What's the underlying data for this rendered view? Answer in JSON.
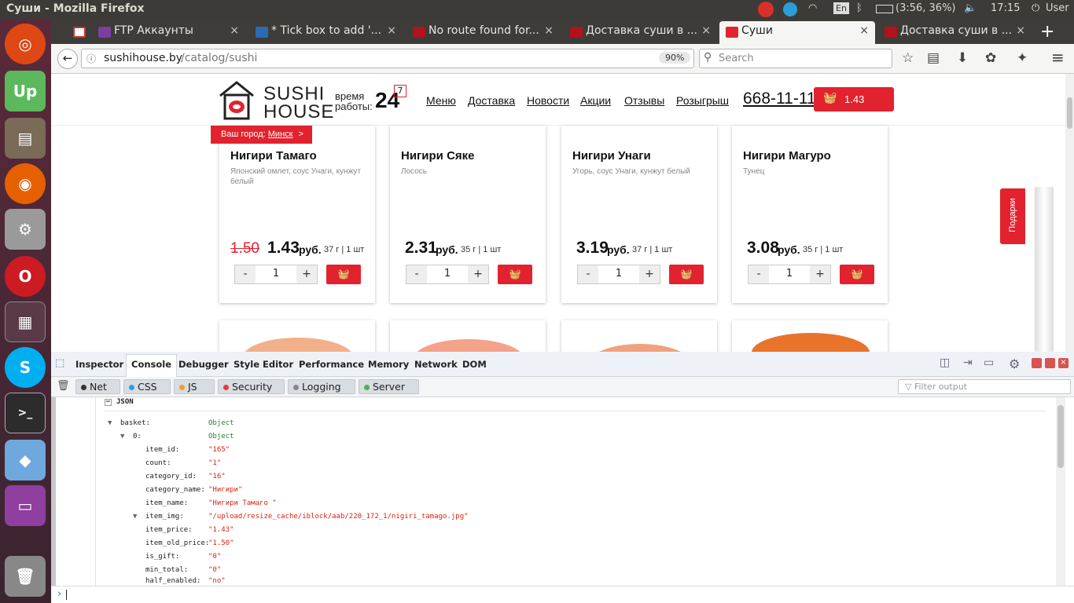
{
  "window": {
    "title": "Суши - Mozilla Firefox"
  },
  "system": {
    "keyboard": "En",
    "battery": "(3:56, 36%)",
    "time": "17:15",
    "user": "User"
  },
  "tabs": [
    {
      "label": "FTP Аккаунты",
      "color": "#7b3fa0"
    },
    {
      "label": "* Tick box to add '...",
      "color": "#2c6bb3"
    },
    {
      "label": "No route found for...",
      "color": "#b2121b"
    },
    {
      "label": "Доставка суши в ...",
      "color": "#b2121b"
    },
    {
      "label": "Суши",
      "color": "#e2222f"
    },
    {
      "label": "Доставка суши в ...",
      "color": "#b2121b"
    }
  ],
  "nav": {
    "url_domain": "sushihouse.by",
    "url_path": "/catalog/sushi",
    "zoom": "90%",
    "search_placeholder": "Search"
  },
  "site": {
    "logo_line1": "SUSHI",
    "logo_line2": "HOUSE",
    "hours_label1": "время",
    "hours_label2": "работы:",
    "hours_value": "24",
    "hours_badge": "7",
    "menu": [
      "Меню",
      "Доставка",
      "Новости",
      "Акции",
      "Отзывы",
      "Розыгрыш"
    ],
    "phone": "668-11-11",
    "cart_total": "1.43",
    "city_label": "Ваш город:",
    "city": "Минск",
    "city_arrow": ">",
    "gifts_tab": "Подарки"
  },
  "products": [
    {
      "name": "Нигири Тамаго",
      "desc": "Японский омлет, соус Унаги, кунжут белый",
      "old_price": "1.50",
      "price": "1.43",
      "currency": "руб.",
      "weight": "37 г | 1 шт",
      "qty": "1"
    },
    {
      "name": "Нигири Сяке",
      "desc": "Лосось",
      "old_price": "",
      "price": "2.31",
      "currency": "руб.",
      "weight": "35 г | 1 шт",
      "qty": "1"
    },
    {
      "name": "Нигири Унаги",
      "desc": "Угорь, соус Унаги, кунжут белый",
      "old_price": "",
      "price": "3.19",
      "currency": "руб.",
      "weight": "37 г | 1 шт",
      "qty": "1"
    },
    {
      "name": "Нигири Магуро",
      "desc": "Тунец",
      "old_price": "",
      "price": "3.08",
      "currency": "руб.",
      "weight": "35 г | 1 шт",
      "qty": "1"
    }
  ],
  "devtools": {
    "tabs": [
      "Inspector",
      "Console",
      "Debugger",
      "Style Editor",
      "Performance",
      "Memory",
      "Network",
      "DOM"
    ],
    "active_tab": "Console",
    "filters": [
      {
        "label": "Net",
        "color": "#333333"
      },
      {
        "label": "CSS",
        "color": "#2aa0e6"
      },
      {
        "label": "JS",
        "color": "#f0a020"
      },
      {
        "label": "Security",
        "color": "#e23c3c"
      },
      {
        "label": "Logging",
        "color": "#888888"
      },
      {
        "label": "Server",
        "color": "#4caf50"
      }
    ],
    "filter_placeholder": "Filter output",
    "json_header": "JSON",
    "tree": [
      {
        "key": "basket:",
        "value": "Object",
        "object": true
      },
      {
        "key": "0:",
        "value": "Object",
        "object": true
      },
      {
        "key": "item_id:",
        "value": "\"165\""
      },
      {
        "key": "count:",
        "value": "\"1\""
      },
      {
        "key": "category_id:",
        "value": "\"16\""
      },
      {
        "key": "category_name:",
        "value": "\"Нигири\""
      },
      {
        "key": "item_name:",
        "value": "\"Нигири Тамаго \""
      },
      {
        "key": "item_img:",
        "value": "\"/upload/resize_cache/iblock/aab/220_172_1/nigiri_tamago.jpg\""
      },
      {
        "key": "item_price:",
        "value": "\"1.43\""
      },
      {
        "key": "item_old_price:",
        "value": "\"1.50\""
      },
      {
        "key": "is_gift:",
        "value": "\"0\""
      },
      {
        "key": "min_total:",
        "value": "\"0\""
      },
      {
        "key": "half_enabled:",
        "value": "\"no\""
      }
    ],
    "prompt": "›"
  }
}
